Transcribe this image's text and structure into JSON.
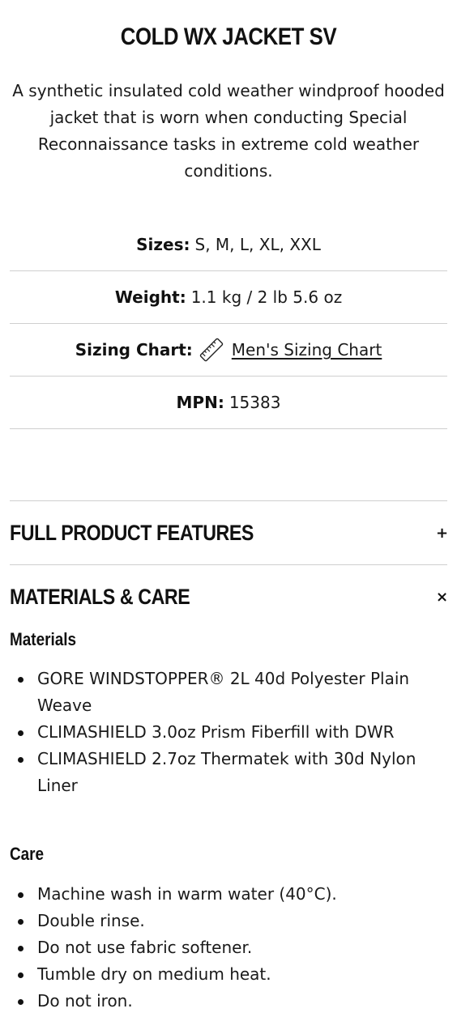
{
  "product": {
    "title": "COLD WX JACKET SV",
    "description": "A synthetic insulated cold weather windproof hooded jacket that is worn when conducting Special Reconnaissance tasks in extreme cold weather conditions."
  },
  "specs": {
    "sizes_label": "Sizes:",
    "sizes_value": "S, M, L, XL, XXL",
    "weight_label": "Weight:",
    "weight_value": "1.1 kg / 2 lb 5.6 oz",
    "sizing_label": "Sizing Chart:",
    "sizing_icon": "ruler-icon",
    "sizing_link": "Men's Sizing Chart",
    "mpn_label": "MPN:",
    "mpn_value": "15383"
  },
  "accordion": {
    "features": {
      "title": "FULL PRODUCT FEATURES",
      "toggle": "+"
    },
    "materials": {
      "title": "MATERIALS & CARE",
      "toggle": "×",
      "materials_heading": "Materials",
      "materials_items": [
        "GORE WINDSTOPPER® 2L 40d Polyester Plain Weave",
        "CLIMASHIELD 3.0oz Prism Fiberfill with DWR",
        "CLIMASHIELD 2.7oz Thermatek with 30d Nylon Liner"
      ],
      "care_heading": "Care",
      "care_items": [
        "Machine wash in warm water (40°C).",
        "Double rinse.",
        "Do not use fabric softener.",
        "Tumble dry on medium heat.",
        "Do not iron."
      ]
    }
  }
}
